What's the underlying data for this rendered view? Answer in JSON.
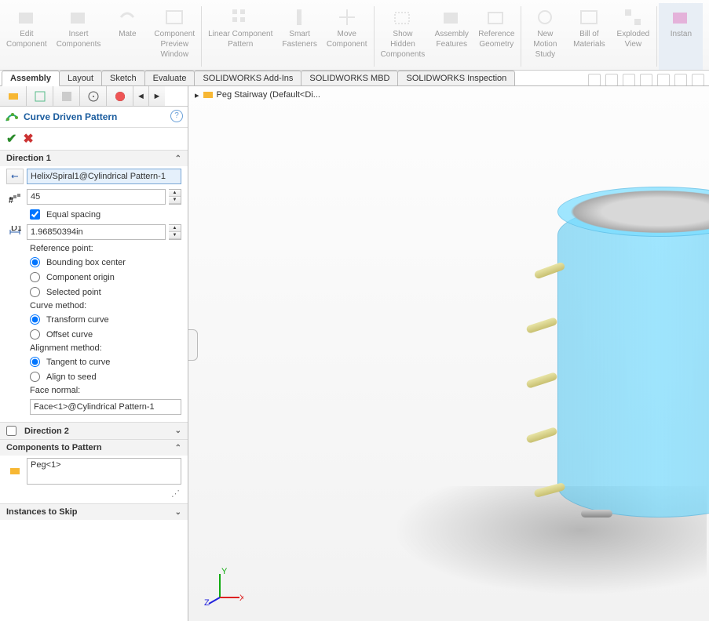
{
  "ribbon": {
    "items": [
      {
        "l1": "Edit",
        "l2": "Component"
      },
      {
        "l1": "Insert",
        "l2": "Components"
      },
      {
        "l1": "Mate",
        "l2": ""
      },
      {
        "l1": "Component",
        "l2": "Preview",
        "l3": "Window"
      },
      {
        "l1": "Linear Component",
        "l2": "Pattern"
      },
      {
        "l1": "Smart",
        "l2": "Fasteners"
      },
      {
        "l1": "Move",
        "l2": "Component"
      },
      {
        "l1": "Show",
        "l2": "Hidden",
        "l3": "Components"
      },
      {
        "l1": "Assembly",
        "l2": "Features"
      },
      {
        "l1": "Reference",
        "l2": "Geometry"
      },
      {
        "l1": "New",
        "l2": "Motion",
        "l3": "Study"
      },
      {
        "l1": "Bill of",
        "l2": "Materials"
      },
      {
        "l1": "Exploded",
        "l2": "View"
      },
      {
        "l1": "Instan",
        "l2": ""
      }
    ]
  },
  "tabs": [
    "Assembly",
    "Layout",
    "Sketch",
    "Evaluate",
    "SOLIDWORKS Add-Ins",
    "SOLIDWORKS MBD",
    "SOLIDWORKS Inspection"
  ],
  "active_tab": 0,
  "breadcrumb": "Peg Stairway  (Default<Di...",
  "feature": {
    "title": "Curve Driven Pattern",
    "dir1": {
      "label": "Direction 1",
      "path": "Helix/Spiral1@Cylindrical Pattern-1",
      "count": "45",
      "equal_spacing_label": "Equal spacing",
      "spacing": "1.96850394in",
      "ref_label": "Reference point:",
      "ref_opts": [
        "Bounding box center",
        "Component origin",
        "Selected point"
      ],
      "curve_label": "Curve method:",
      "curve_opts": [
        "Transform curve",
        "Offset curve"
      ],
      "align_label": "Alignment method:",
      "align_opts": [
        "Tangent to curve",
        "Align to seed"
      ],
      "facenorm_label": "Face normal:",
      "facenorm": "Face<1>@Cylindrical Pattern-1"
    },
    "dir2_label": "Direction 2",
    "comp_label": "Components to Pattern",
    "comp": "Peg<1>",
    "skip_label": "Instances to Skip"
  }
}
